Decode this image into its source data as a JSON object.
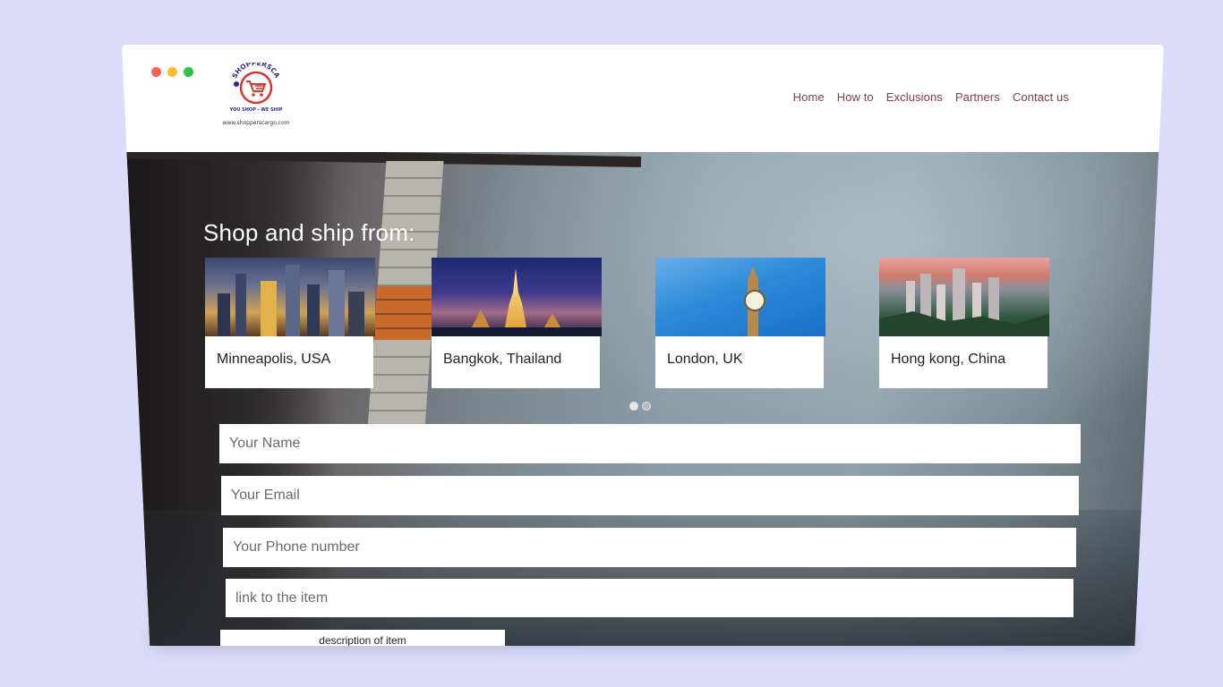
{
  "browser": {
    "dots": [
      "red",
      "yellow",
      "green"
    ]
  },
  "logo": {
    "name": "SHOPPERSCARGO",
    "tagline": "YOU SHOP - WE SHIP",
    "url": "www.shopperscargo.com"
  },
  "nav": {
    "items": [
      {
        "label": "Home"
      },
      {
        "label": "How to"
      },
      {
        "label": "Exclusions"
      },
      {
        "label": "Partners"
      },
      {
        "label": "Contact us"
      }
    ]
  },
  "hero": {
    "title": "Shop and ship from:"
  },
  "cities": [
    {
      "label": "Minneapolis, USA",
      "image": "minneapolis-skyline"
    },
    {
      "label": "Bangkok, Thailand",
      "image": "bangkok-temple"
    },
    {
      "label": "London, UK",
      "image": "big-ben-clock-tower"
    },
    {
      "label": "Hong kong, China",
      "image": "hong-kong-skyline"
    }
  ],
  "slider": {
    "pages": 2,
    "active_index": 0
  },
  "form": {
    "name_placeholder": "Your Name",
    "email_placeholder": "Your Email",
    "phone_placeholder": "Your Phone number",
    "link_placeholder": "link to the item",
    "description_placeholder": "description of item"
  },
  "colors": {
    "page_background": "#dcdcfa",
    "nav_link": "#8a3b3b",
    "logo_primary": "#d8342c",
    "logo_secondary": "#2a2a8a"
  }
}
